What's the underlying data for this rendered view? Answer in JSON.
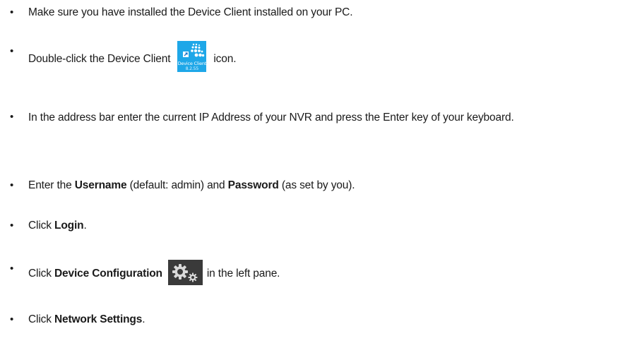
{
  "steps": [
    {
      "text": "Make sure you have installed the Device Client installed on your PC."
    },
    {
      "before": "Double-click the Device Client",
      "after": "icon.",
      "icon": "device-client-icon"
    },
    {
      "text": "In the address bar enter the current IP Address of your NVR and press the Enter key of your keyboard."
    },
    {
      "t1": "Enter the ",
      "b1": "Username",
      "t2": " (default: admin) and ",
      "b2": "Password",
      "t3": " (as set by you)."
    },
    {
      "t1": "Click ",
      "b1": "Login",
      "t2": "."
    },
    {
      "t1": "Click ",
      "b1": "Device Configuration",
      "t2": "in the left pane.",
      "icon": "gears-icon"
    },
    {
      "t1": "Click ",
      "b1": "Network Settings",
      "t2": "."
    }
  ],
  "bullet": "•",
  "device_client_icon": {
    "caption": "Device Client",
    "version": "8.2.55",
    "color": "#1ea7e8"
  },
  "gears_icon": {
    "color": "#3a3a3a"
  }
}
